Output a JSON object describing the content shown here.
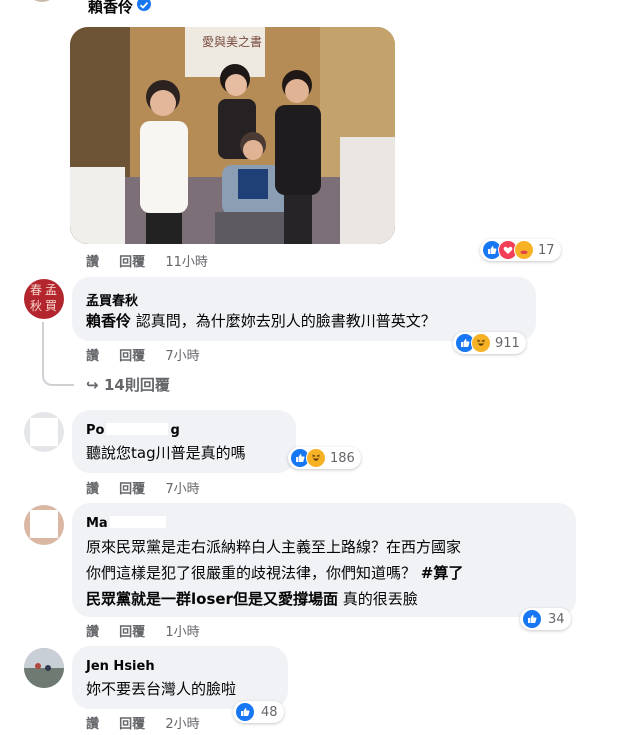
{
  "top_author": {
    "name": "賴香伶"
  },
  "photo_post": {
    "banner_text": "愛與美之書",
    "actions": {
      "like": "讚",
      "reply": "回覆",
      "time": "11小時"
    },
    "reactions": {
      "count": "17"
    }
  },
  "comments": [
    {
      "name": "孟買春秋",
      "avatar_text": [
        "春",
        "孟",
        "秋",
        "買"
      ],
      "mention": "賴香伶",
      "text_after_mention": " 認真問，為什麼妳去別人的臉書教川普英文？",
      "actions": {
        "like": "讚",
        "reply": "回覆",
        "time": "7小時"
      },
      "reactions": {
        "count": "911"
      },
      "replies_link": "14則回覆"
    },
    {
      "name": "Po",
      "name_tail": "g",
      "lines": [
        "聽說您tag川普是真的嗎"
      ],
      "actions": {
        "like": "讚",
        "reply": "回覆",
        "time": "7小時"
      },
      "reactions": {
        "count": "186"
      }
    },
    {
      "name": "Ma",
      "line1": "原來民眾黨是走右派納粹白人主義至上路線？在西方國家",
      "line2_plain": "你們這樣是犯了很嚴重的歧視法律，你們知道嗎？ ",
      "line2_bold": "#算了",
      "line3_bold": "民眾黨就是一群loser但是又愛撐場面",
      "line3_plain": " 真的很丟臉",
      "actions": {
        "like": "讚",
        "reply": "回覆",
        "time": "1小時"
      },
      "reactions": {
        "count": "34"
      }
    },
    {
      "name": "Jen Hsieh",
      "lines": [
        "妳不要丟台灣人的臉啦"
      ],
      "actions": {
        "like": "讚",
        "reply": "回覆",
        "time": "2小時"
      },
      "reactions": {
        "count": "48"
      }
    }
  ],
  "colors": {
    "like_blue": "#1877f2",
    "bubble_bg": "#f0f2f5",
    "meta_gray": "#65676b",
    "seal_red": "#b3262d"
  }
}
